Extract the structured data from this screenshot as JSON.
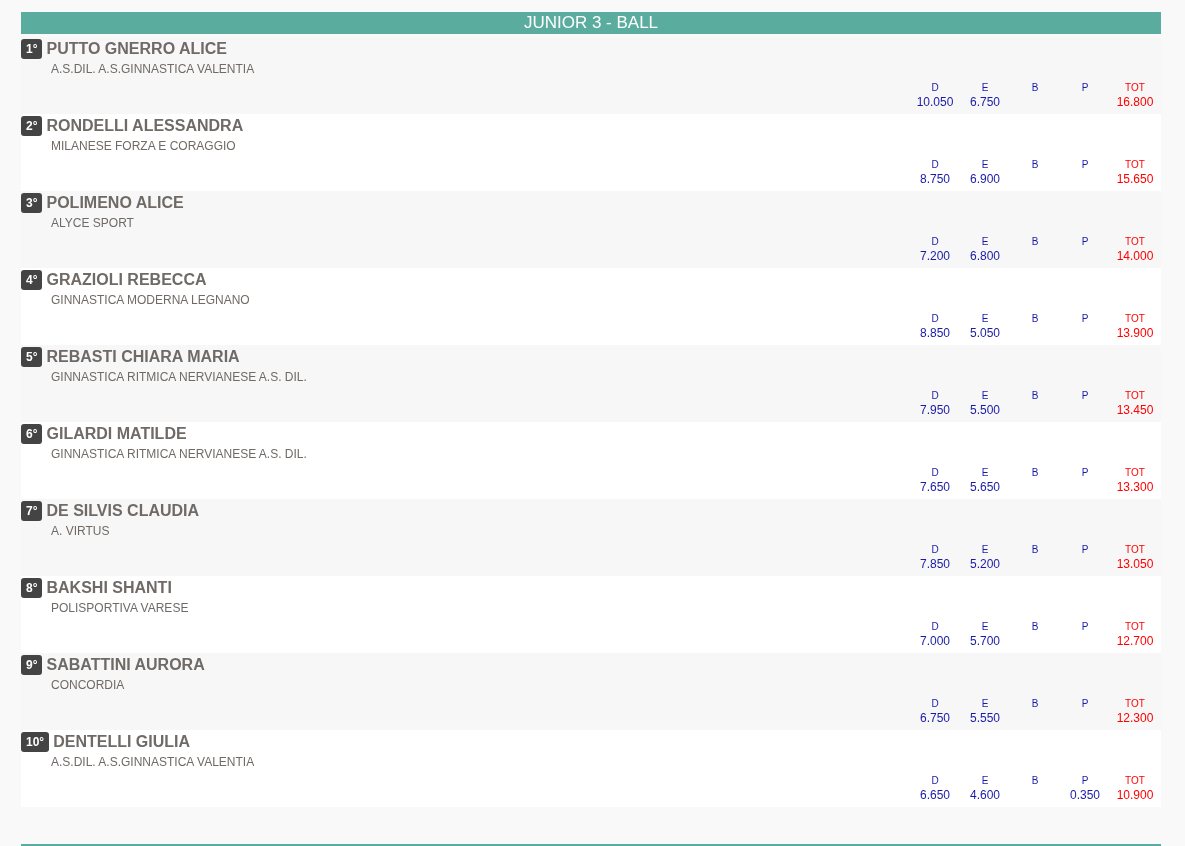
{
  "section": {
    "title": "JUNIOR 3 - BALL"
  },
  "athletes": [
    {
      "rank": "1°",
      "name": "PUTTO GNERRO ALICE",
      "club": "A.S.DIL. A.S.GINNASTICA VALENTIA",
      "scores": [
        {
          "kind": "score",
          "label": "D",
          "value": "10.050"
        },
        {
          "kind": "score",
          "label": "E",
          "value": "6.750"
        },
        {
          "kind": "score",
          "label": "B"
        },
        {
          "kind": "score",
          "label": "P"
        },
        {
          "kind": "total",
          "label": "TOT",
          "value": "16.800"
        }
      ]
    },
    {
      "rank": "2°",
      "name": "RONDELLI ALESSANDRA",
      "club": "MILANESE FORZA E CORAGGIO",
      "scores": [
        {
          "kind": "score",
          "label": "D",
          "value": "8.750"
        },
        {
          "kind": "score",
          "label": "E",
          "value": "6.900"
        },
        {
          "kind": "score",
          "label": "B"
        },
        {
          "kind": "score",
          "label": "P"
        },
        {
          "kind": "total",
          "label": "TOT",
          "value": "15.650"
        }
      ]
    },
    {
      "rank": "3°",
      "name": "POLIMENO ALICE",
      "club": "ALYCE SPORT",
      "scores": [
        {
          "kind": "score",
          "label": "D",
          "value": "7.200"
        },
        {
          "kind": "score",
          "label": "E",
          "value": "6.800"
        },
        {
          "kind": "score",
          "label": "B"
        },
        {
          "kind": "score",
          "label": "P"
        },
        {
          "kind": "total",
          "label": "TOT",
          "value": "14.000"
        }
      ]
    },
    {
      "rank": "4°",
      "name": "GRAZIOLI REBECCA",
      "club": "GINNASTICA MODERNA LEGNANO",
      "scores": [
        {
          "kind": "score",
          "label": "D",
          "value": "8.850"
        },
        {
          "kind": "score",
          "label": "E",
          "value": "5.050"
        },
        {
          "kind": "score",
          "label": "B"
        },
        {
          "kind": "score",
          "label": "P"
        },
        {
          "kind": "total",
          "label": "TOT",
          "value": "13.900"
        }
      ]
    },
    {
      "rank": "5°",
      "name": "REBASTI CHIARA MARIA",
      "club": "GINNASTICA RITMICA NERVIANESE A.S. DIL.",
      "scores": [
        {
          "kind": "score",
          "label": "D",
          "value": "7.950"
        },
        {
          "kind": "score",
          "label": "E",
          "value": "5.500"
        },
        {
          "kind": "score",
          "label": "B"
        },
        {
          "kind": "score",
          "label": "P"
        },
        {
          "kind": "total",
          "label": "TOT",
          "value": "13.450"
        }
      ]
    },
    {
      "rank": "6°",
      "name": "GILARDI MATILDE",
      "club": "GINNASTICA RITMICA NERVIANESE A.S. DIL.",
      "scores": [
        {
          "kind": "score",
          "label": "D",
          "value": "7.650"
        },
        {
          "kind": "score",
          "label": "E",
          "value": "5.650"
        },
        {
          "kind": "score",
          "label": "B"
        },
        {
          "kind": "score",
          "label": "P"
        },
        {
          "kind": "total",
          "label": "TOT",
          "value": "13.300"
        }
      ]
    },
    {
      "rank": "7°",
      "name": "DE SILVIS CLAUDIA",
      "club": "A. VIRTUS",
      "scores": [
        {
          "kind": "score",
          "label": "D",
          "value": "7.850"
        },
        {
          "kind": "score",
          "label": "E",
          "value": "5.200"
        },
        {
          "kind": "score",
          "label": "B"
        },
        {
          "kind": "score",
          "label": "P"
        },
        {
          "kind": "total",
          "label": "TOT",
          "value": "13.050"
        }
      ]
    },
    {
      "rank": "8°",
      "name": "BAKSHI SHANTI",
      "club": "POLISPORTIVA VARESE",
      "scores": [
        {
          "kind": "score",
          "label": "D",
          "value": "7.000"
        },
        {
          "kind": "score",
          "label": "E",
          "value": "5.700"
        },
        {
          "kind": "score",
          "label": "B"
        },
        {
          "kind": "score",
          "label": "P"
        },
        {
          "kind": "total",
          "label": "TOT",
          "value": "12.700"
        }
      ]
    },
    {
      "rank": "9°",
      "name": "SABATTINI AURORA",
      "club": "CONCORDIA",
      "scores": [
        {
          "kind": "score",
          "label": "D",
          "value": "6.750"
        },
        {
          "kind": "score",
          "label": "E",
          "value": "5.550"
        },
        {
          "kind": "score",
          "label": "B"
        },
        {
          "kind": "score",
          "label": "P"
        },
        {
          "kind": "total",
          "label": "TOT",
          "value": "12.300"
        }
      ]
    },
    {
      "rank": "10°",
      "name": "DENTELLI GIULIA",
      "club": "A.S.DIL. A.S.GINNASTICA VALENTIA",
      "scores": [
        {
          "kind": "score",
          "label": "D",
          "value": "6.650"
        },
        {
          "kind": "score",
          "label": "E",
          "value": "4.600"
        },
        {
          "kind": "score",
          "label": "B"
        },
        {
          "kind": "score",
          "label": "P",
          "value": "0.350"
        },
        {
          "kind": "total",
          "label": "TOT",
          "value": "10.900"
        }
      ]
    }
  ]
}
